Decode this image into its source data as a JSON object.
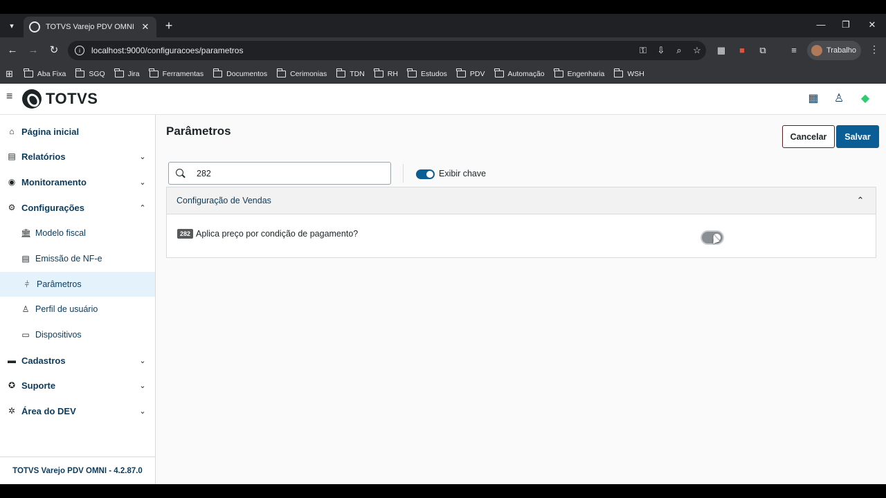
{
  "browser": {
    "tab_title": "TOTVS Varejo PDV OMNI",
    "url": "localhost:9000/configuracoes/parametros",
    "profile_name": "Trabalho",
    "bookmarks": [
      "Aba Fixa",
      "SGQ",
      "Jira",
      "Ferramentas",
      "Documentos",
      "Cerimonias",
      "TDN",
      "RH",
      "Estudos",
      "PDV",
      "Automação",
      "Engenharia",
      "WSH"
    ]
  },
  "app": {
    "logo_text": "TOTVS",
    "colors": {
      "primary": "#0b5e95",
      "menu_text": "#0c3a5a",
      "status_green": "#2ecc71",
      "active_bg": "#e3f2fb"
    }
  },
  "sidebar": {
    "items": [
      {
        "label": "Página inicial",
        "icon": "home-icon"
      },
      {
        "label": "Relatórios",
        "icon": "report-icon"
      },
      {
        "label": "Monitoramento",
        "icon": "broadcast-icon"
      },
      {
        "label": "Configurações",
        "icon": "gear-icon"
      },
      {
        "label": "Cadastros",
        "icon": "card-icon"
      },
      {
        "label": "Suporte",
        "icon": "lifebuoy-icon"
      },
      {
        "label": "Área do DEV",
        "icon": "bug-icon"
      }
    ],
    "sub_items": [
      {
        "label": "Modelo fiscal"
      },
      {
        "label": "Emissão de NF-e"
      },
      {
        "label": "Parâmetros"
      },
      {
        "label": "Perfil de usuário"
      },
      {
        "label": "Dispositivos"
      }
    ],
    "version": "TOTVS Varejo PDV OMNI - 4.2.87.0"
  },
  "page": {
    "title": "Parâmetros",
    "cancel_label": "Cancelar",
    "save_label": "Salvar",
    "search_value": "282",
    "show_key_label": "Exibir chave",
    "show_key_on": true
  },
  "accordion": {
    "title": "Configuração de Vendas",
    "expanded": true,
    "param": {
      "key": "282",
      "label": "Aplica preço por condição de pagamento?",
      "enabled": false
    }
  }
}
